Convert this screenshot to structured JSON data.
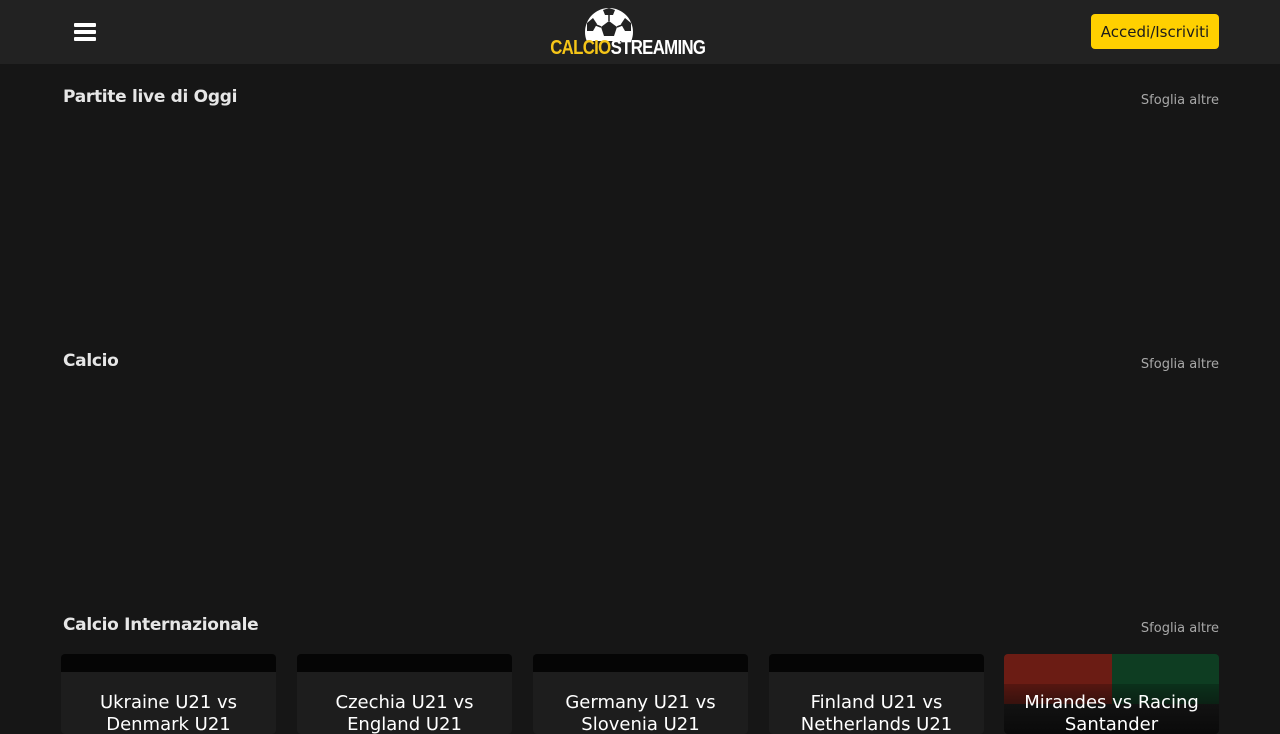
{
  "header": {
    "logo_part1": "CALCIO",
    "logo_part2": "STREAMING",
    "login_label": "Accedi/Iscriviti"
  },
  "sections": [
    {
      "title": "Partite live di Oggi",
      "browse_label": "Sfoglia altre"
    },
    {
      "title": "Calcio",
      "browse_label": "Sfoglia altre"
    },
    {
      "title": "Calcio Internazionale",
      "browse_label": "Sfoglia altre"
    }
  ],
  "cards": [
    {
      "title": "Ukraine U21 vs Denmark U21"
    },
    {
      "title": "Czechia U21 vs England U21"
    },
    {
      "title": "Germany U21 vs Slovenia U21"
    },
    {
      "title": "Finland U21 vs Netherlands U21"
    },
    {
      "title": "Mirandes vs Racing Santander"
    }
  ],
  "colors": {
    "accent": "#ffd000",
    "background": "#161616",
    "header": "#222222"
  }
}
